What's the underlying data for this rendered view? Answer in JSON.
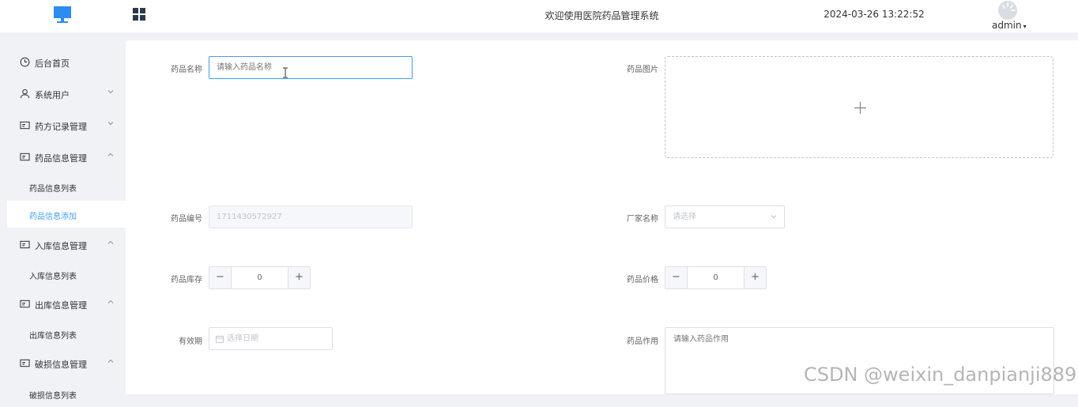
{
  "header": {
    "title": "欢迎使用医院药品管理系统",
    "datetime": "2024-03-26 13:22:52",
    "user": "admin",
    "logo_icon": "monitor-icon",
    "menu_toggle_icon": "grid-icon"
  },
  "sidebar": {
    "items": [
      {
        "label": "后台首页",
        "icon": "clock-icon"
      },
      {
        "label": "系统用户",
        "icon": "user-icon",
        "expanded": false
      },
      {
        "label": "药方记录管理",
        "icon": "card-icon",
        "expanded": false
      },
      {
        "label": "药品信息管理",
        "icon": "card-icon",
        "expanded": true,
        "children": [
          "药品信息列表",
          "药品信息添加"
        ]
      },
      {
        "label": "入库信息管理",
        "icon": "card-icon",
        "expanded": true,
        "children": [
          "入库信息列表"
        ]
      },
      {
        "label": "出库信息管理",
        "icon": "card-icon",
        "expanded": true,
        "children": [
          "出库信息列表"
        ]
      },
      {
        "label": "破损信息管理",
        "icon": "card-icon",
        "expanded": true,
        "children": [
          "破损信息列表"
        ]
      }
    ],
    "active": "药品信息添加"
  },
  "form": {
    "name_label": "药品名称",
    "name_placeholder": "请输入药品名称",
    "image_label": "药品图片",
    "code_label": "药品编号",
    "code_value": "1711430572927",
    "vendor_label": "厂家名称",
    "vendor_placeholder": "请选择",
    "stock_label": "药品库存",
    "stock_value": "0",
    "price_label": "药品价格",
    "price_value": "0",
    "expiry_label": "有效期",
    "expiry_placeholder": "选择日期",
    "effect_label": "药品作用",
    "effect_placeholder": "请输入药品作用"
  },
  "watermark": "CSDN @weixin_danpianji889",
  "colors": {
    "accent": "#409eff",
    "background": "#f0f2f5",
    "nav_icon": "#2b3a4a"
  }
}
